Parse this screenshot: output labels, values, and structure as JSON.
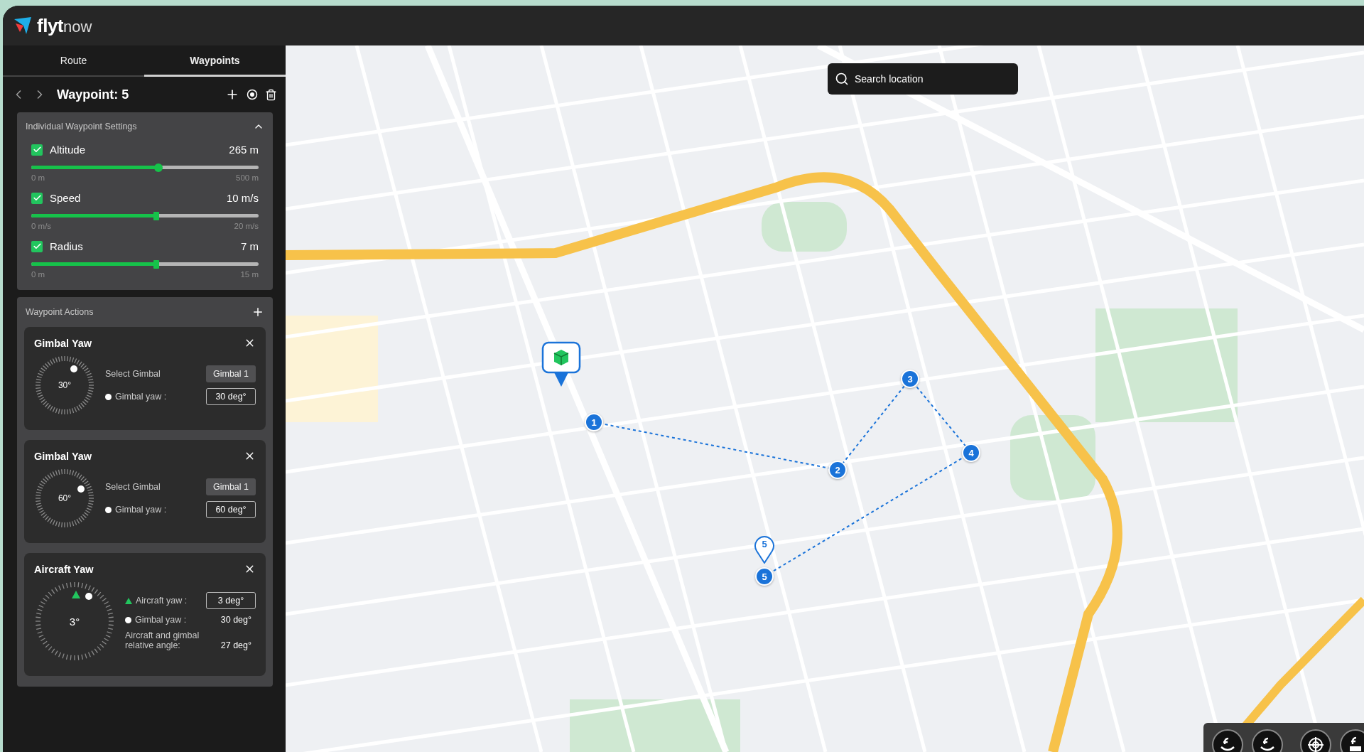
{
  "logo": {
    "name_bold": "flyt",
    "name_light": "now"
  },
  "tabs": [
    {
      "label": "Route",
      "selected": false
    },
    {
      "label": "Waypoints",
      "selected": true
    }
  ],
  "waypoint_header": {
    "title": "Waypoint: 5"
  },
  "settings": {
    "title": "Individual Waypoint Settings",
    "expanded": true,
    "params": [
      {
        "label": "Altitude",
        "checked": true,
        "reading": "265 m",
        "level": 0.56,
        "min": "0 m",
        "max": "500 m"
      },
      {
        "label": "Speed",
        "checked": true,
        "reading": "10 m/s",
        "level": 0.55,
        "min": "0 m/s",
        "max": "20 m/s"
      },
      {
        "label": "Radius",
        "checked": true,
        "reading": "7 m",
        "level": 0.55,
        "min": "0 m",
        "max": "15 m"
      }
    ]
  },
  "actions": {
    "title": "Waypoint Actions",
    "items": [
      {
        "kind": "gimbal",
        "title": "Gimbal Yaw",
        "dial_label": "30°",
        "select_label": "Select Gimbal",
        "select_value": "Gimbal 1",
        "yaw_label": "Gimbal yaw :",
        "yaw_value": "30 deg°"
      },
      {
        "kind": "gimbal",
        "title": "Gimbal Yaw",
        "dial_label": "60°",
        "select_label": "Select Gimbal",
        "select_value": "Gimbal 1",
        "yaw_label": "Gimbal yaw :",
        "yaw_value": "60 deg°"
      },
      {
        "kind": "aircraft",
        "title": "Aircraft Yaw",
        "dial_label": "3°",
        "aircraft_label": "Aircraft yaw :",
        "aircraft_value": "3 deg°",
        "gimbal_label": "Gimbal yaw :",
        "gimbal_value": "30 deg°",
        "relative_label": "Aircraft and gimbal relative angle:",
        "relative_value": "27 deg°"
      }
    ]
  },
  "map": {
    "search": {
      "placeholder": "Search location"
    },
    "waypoints": [
      {
        "label": "1",
        "selected": false
      },
      {
        "label": "2",
        "selected": false
      },
      {
        "label": "3",
        "selected": false
      },
      {
        "label": "4",
        "selected": false
      },
      {
        "label": "5",
        "selected": true,
        "pin_label": "5"
      }
    ]
  }
}
